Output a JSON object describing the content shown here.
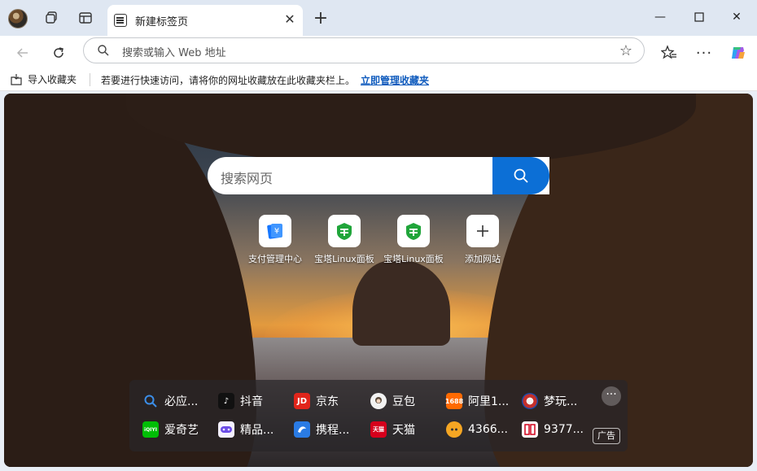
{
  "tab": {
    "title": "新建标签页",
    "close": "✕",
    "new": "+"
  },
  "window": {
    "minimize": "—",
    "maximize": "☐",
    "close": "✕"
  },
  "address": {
    "placeholder": "搜索或输入 Web 地址"
  },
  "favorites_bar": {
    "import_label": "导入收藏夹",
    "hint": "若要进行快速访问，请将你的网址收藏放在此收藏夹栏上。",
    "manage_link": "立即管理收藏夹"
  },
  "search": {
    "placeholder": "搜索网页"
  },
  "quick_links": [
    {
      "label": "支付管理中心",
      "icon": "alipay-icon",
      "color": "#1677ff"
    },
    {
      "label": "宝塔Linux面板",
      "icon": "bt-panel-icon",
      "color": "#20a53a"
    },
    {
      "label": "宝塔Linux面板",
      "icon": "bt-panel-icon",
      "color": "#20a53a"
    },
    {
      "label": "添加网站",
      "icon": "plus-icon",
      "color": "#333333"
    }
  ],
  "site_links": [
    {
      "label": "必应...",
      "icon": "bing-search-icon",
      "color": "#2e7bd6"
    },
    {
      "label": "抖音",
      "icon": "douyin-icon",
      "color": "#111111"
    },
    {
      "label": "京东",
      "icon": "jd-icon",
      "color": "#e1251b"
    },
    {
      "label": "豆包",
      "icon": "doubao-icon",
      "color": "#f2f2f2"
    },
    {
      "label": "阿里1...",
      "icon": "1688-icon",
      "color": "#ff6a00"
    },
    {
      "label": "梦玩...",
      "icon": "mengwan-icon",
      "color": "#c4302b"
    },
    {
      "label": "爱奇艺",
      "icon": "iqiyi-icon",
      "color": "#00be06"
    },
    {
      "label": "精品...",
      "icon": "game-icon",
      "color": "#6b4ce6"
    },
    {
      "label": "携程...",
      "icon": "ctrip-icon",
      "color": "#2a7be4"
    },
    {
      "label": "天猫",
      "icon": "tmall-icon",
      "color": "#d6001c"
    },
    {
      "label": "4366...",
      "icon": "4366-icon",
      "color": "#f5a623"
    },
    {
      "label": "9377...",
      "icon": "9377-icon",
      "color": "#d0021b"
    }
  ],
  "more": "···",
  "ad_label": "广告"
}
